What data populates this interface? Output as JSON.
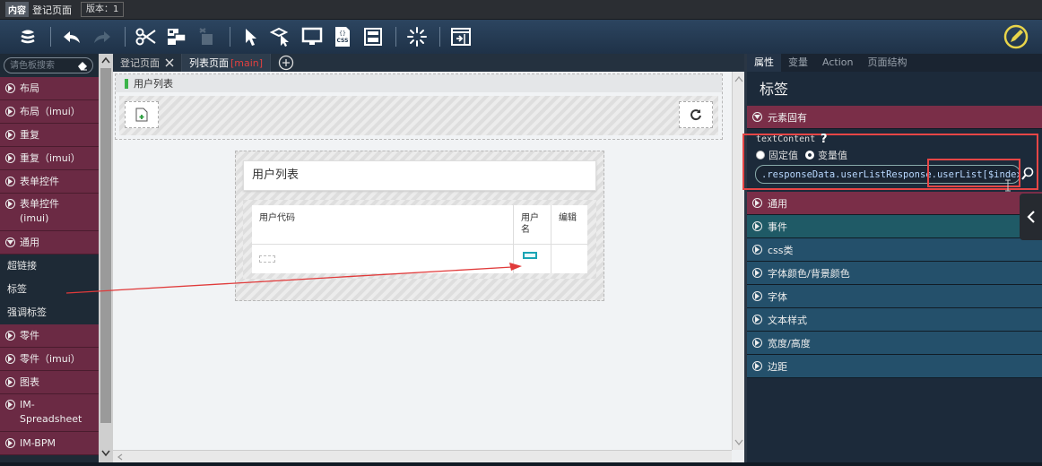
{
  "titlebar": {
    "badge": "内容",
    "title": "登记页面",
    "version": "版本：1"
  },
  "toolbar": {
    "icons": [
      "layers-icon",
      "undo-icon",
      "redo-icon",
      "cut-icon",
      "component-icon",
      "delete-component-icon",
      "pointer-icon",
      "hover-icon",
      "preview-icon",
      "css-icon",
      "component-detail-icon",
      "loading-icon",
      "expand-icon",
      "edit-icon"
    ],
    "css_label": "CSS"
  },
  "palette": {
    "search_placeholder": "请色板搜索",
    "items": [
      {
        "label": "布局",
        "type": "category"
      },
      {
        "label": "布局（imui）",
        "type": "category"
      },
      {
        "label": "重复",
        "type": "category"
      },
      {
        "label": "重复（imui）",
        "type": "category"
      },
      {
        "label": "表单控件",
        "type": "category"
      },
      {
        "label": "表单控件\n(imui)",
        "type": "category"
      },
      {
        "label": "通用",
        "type": "category-open"
      },
      {
        "label": "超链接",
        "type": "item"
      },
      {
        "label": "标签",
        "type": "item"
      },
      {
        "label": "强调标签",
        "type": "item"
      },
      {
        "label": "零件",
        "type": "category"
      },
      {
        "label": "零件（imui）",
        "type": "category"
      },
      {
        "label": "图表",
        "type": "category"
      },
      {
        "label": "IM-\nSpreadsheet",
        "type": "category"
      },
      {
        "label": "IM-BPM",
        "type": "category"
      }
    ]
  },
  "editor": {
    "tabs": [
      {
        "label": "登记页面",
        "closable": true,
        "active": false
      },
      {
        "label": "列表页面",
        "suffix": "[main]",
        "active": true
      }
    ],
    "add_tab_icon": "plus-circle-icon",
    "outer_panel_title": "用户列表",
    "inner_panel_title": "用户列表",
    "table_headers": [
      "用户代码",
      "用户名",
      "编辑"
    ]
  },
  "properties": {
    "tabs": [
      "属性",
      "变量",
      "Action",
      "页面结构"
    ],
    "active_tab": "属性",
    "title": "标签",
    "sections": [
      {
        "label": "元素固有",
        "color": "pink",
        "open": true
      },
      {
        "label": "通用",
        "color": "pink",
        "open": false
      },
      {
        "label": "事件",
        "color": "teal",
        "open": false
      },
      {
        "label": "css类",
        "color": "blue",
        "open": false
      },
      {
        "label": "字体颜色/背景颜色",
        "color": "blue",
        "open": false
      },
      {
        "label": "字体",
        "color": "blue",
        "open": false
      },
      {
        "label": "文本样式",
        "color": "blue",
        "open": false
      },
      {
        "label": "宽度/高度",
        "color": "blue",
        "open": false
      },
      {
        "label": "边距",
        "color": "blue",
        "open": false
      }
    ],
    "text_content": {
      "label": "textContent",
      "help": "?",
      "radio_fixed": "固定值",
      "radio_variable": "变量值",
      "selected": "变量值",
      "value": ".responseData.userListResponse.userList[$index"
    }
  },
  "colors": {
    "accent_red": "#e64646",
    "category_pink": "#6b2a44",
    "edit_yellow": "#e8d44a"
  }
}
